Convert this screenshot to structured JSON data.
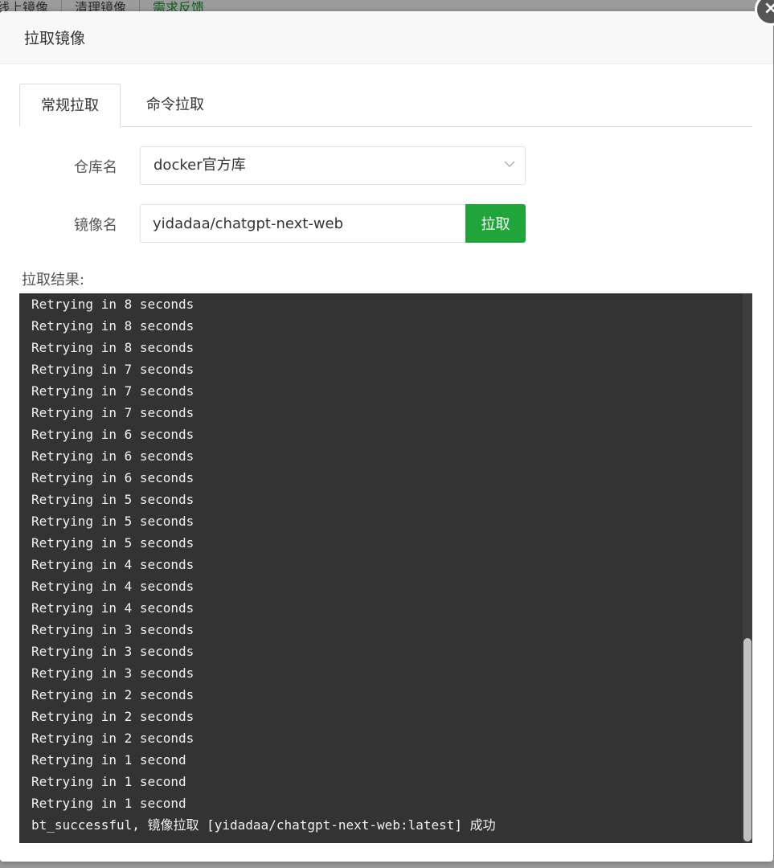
{
  "background": {
    "toolbar_buttons": [
      "线上镜像",
      "清理镜像",
      "需求反馈"
    ]
  },
  "modal": {
    "title": "拉取镜像",
    "close_symbol": "×",
    "tabs": [
      {
        "label": "常规拉取",
        "active": true
      },
      {
        "label": "命令拉取",
        "active": false
      }
    ],
    "form": {
      "repo_label": "仓库名",
      "repo_value": "docker官方库",
      "image_label": "镜像名",
      "image_value": "yidadaa/chatgpt-next-web",
      "pull_button": "拉取"
    },
    "result_label": "拉取结果:",
    "console_lines": [
      "Retrying in 8 seconds",
      "Retrying in 8 seconds",
      "Retrying in 8 seconds",
      "Retrying in 7 seconds",
      "Retrying in 7 seconds",
      "Retrying in 7 seconds",
      "Retrying in 6 seconds",
      "Retrying in 6 seconds",
      "Retrying in 6 seconds",
      "Retrying in 5 seconds",
      "Retrying in 5 seconds",
      "Retrying in 5 seconds",
      "Retrying in 4 seconds",
      "Retrying in 4 seconds",
      "Retrying in 4 seconds",
      "Retrying in 3 seconds",
      "Retrying in 3 seconds",
      "Retrying in 3 seconds",
      "Retrying in 2 seconds",
      "Retrying in 2 seconds",
      "Retrying in 2 seconds",
      "Retrying in 1 second",
      "Retrying in 1 second",
      "Retrying in 1 second",
      "bt_successful, 镜像拉取 [yidadaa/chatgpt-next-web:latest] 成功"
    ]
  },
  "colors": {
    "accent_green": "#20a53a",
    "console_bg": "#333333",
    "console_text": "#f2f2f2"
  }
}
